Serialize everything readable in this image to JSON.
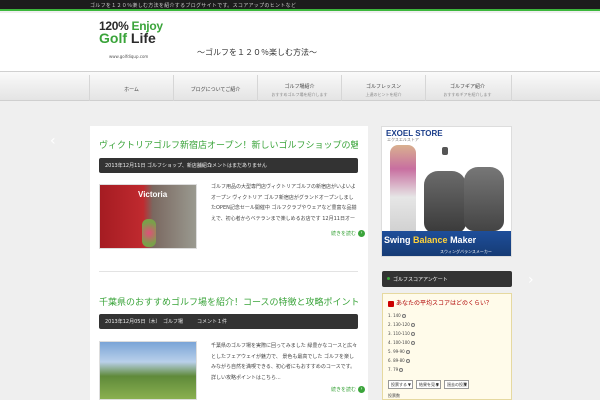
{
  "topbar": {
    "text": "ゴルフを１２０％楽しむ方法を紹介するブログサイトです。スコアアップのヒントなど"
  },
  "logo": {
    "line1a": "120%",
    "line1b": "Enjoy",
    "line2a": "Golf",
    "line2b": "Life",
    "url": "www.golfdiqup.com"
  },
  "tagline": "〜ゴルフを１２０％楽しむ方法〜",
  "nav": [
    {
      "label": "ホーム",
      "sub": ""
    },
    {
      "label": "ブログについてご紹介",
      "sub": ""
    },
    {
      "label": "ゴルフ場紹介",
      "sub": "おすすめゴルフ場を紹介します"
    },
    {
      "label": "ゴルフレッスン",
      "sub": "上達のヒントを紹介"
    },
    {
      "label": "ゴルフギア紹介",
      "sub": "おすすめギアを紹介します"
    }
  ],
  "posts": [
    {
      "title": "ヴィクトリアゴルフ新宿店オープン！新しいゴルフショップの魅力を紹介します",
      "meta": [
        "2013年12月11日",
        "ゴルフショップ、新店舗紹介",
        "コメントはまだありません"
      ],
      "thumb_label": "Victoria",
      "excerpt": "ゴルフ用品の大型専門店ヴィクトリアゴルフの新宿店がいよいよオープン ヴィクトリア ゴルフ新宿店がグランドオープンしましたOPEN記念セール開催中 ゴルフクラブやウェアなど豊富な品揃えで、初心者からベテランまで楽しめるお店です 12月11日オープンの新店舗...",
      "more": "続きを読む"
    },
    {
      "title": "千葉県のおすすめゴルフ場を紹介！コースの特徴と攻略ポイントをまとめました",
      "meta": [
        "2013年12月05日（木）",
        "ゴルフ場",
        "コメント１件"
      ],
      "thumb_label": "",
      "excerpt": "千葉県のゴルフ場を実際に回ってみました 緑豊かなコースと広々としたフェアウェイが魅力で、 景色も最高でした ゴルフを楽しみながら自然を満喫できる、初心者にもおすすめのコースです。詳しい攻略ポイントはこちら...",
      "more": "続きを読む"
    }
  ],
  "banner": {
    "store": "EXOEL STORE",
    "store_sub": "エクスエルストア",
    "sw1": "Swing",
    "sw2": "Balance",
    "sw3": "Maker",
    "sw_sub": "スウィングバランスメーカー"
  },
  "widget": {
    "title": "ゴルフスコアアンケート"
  },
  "poll": {
    "title": "あなたの平均スコアはどのくらい？",
    "options": [
      "1. 140",
      "2. 130-120",
      "3. 110-110",
      "4. 100-100",
      "5. 99-90",
      "6. 89-80",
      "7. 79"
    ],
    "selects": [
      "投票する",
      "結果を見る",
      "過去の投票"
    ],
    "footer": "投票数"
  }
}
